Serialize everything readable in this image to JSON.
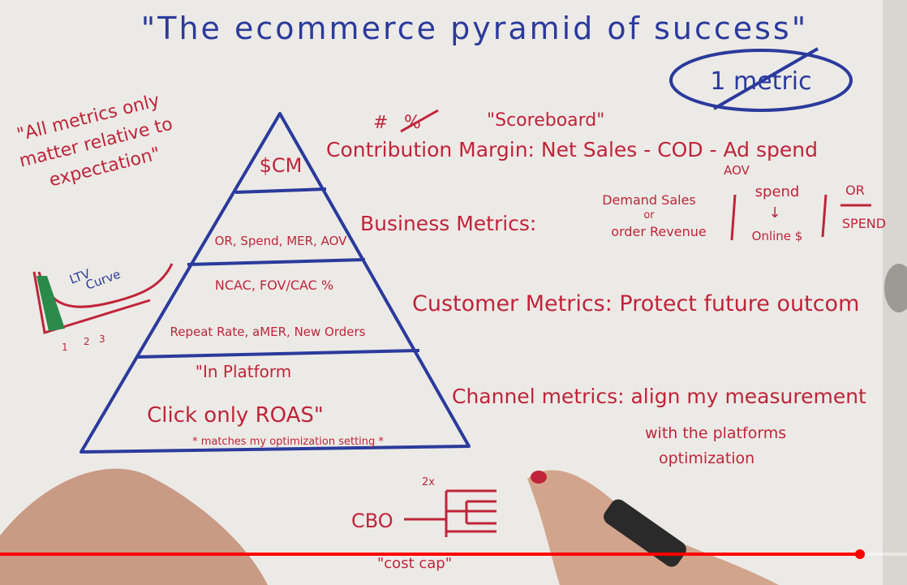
{
  "title": "\"The ecommerce pyramid of success\"",
  "one_metric": "1 metric",
  "quote": [
    "\"All metrics only",
    "matter relative to",
    "expectation\""
  ],
  "ltv": {
    "label1": "LTV",
    "label2": "Curve",
    "ticks": [
      "1",
      "2",
      "3"
    ]
  },
  "scoreboard": {
    "hash": "#",
    "struck": "%",
    "label": "\"Scoreboard\""
  },
  "pyramid": {
    "tier1": "$CM",
    "tier2": "OR, Spend, MER, AOV",
    "tier3a": "NCAC, FOV/CAC %",
    "tier3b": "Repeat Rate, aMER, New Orders",
    "tier4a": "\"In Platform",
    "tier4b": "Click only ROAS\"",
    "tier4c": "* matches my optimization setting *"
  },
  "contribution": "Contribution Margin: Net Sales - COD - Ad spend",
  "business": {
    "label": "Business Metrics:",
    "col1": [
      "Demand Sales",
      "or",
      "order Revenue"
    ],
    "aov": "AOV",
    "col2": [
      "spend",
      "↓",
      "Online $"
    ],
    "col3": [
      "OR",
      "SPEND"
    ]
  },
  "customer": "Customer Metrics: Protect future outcom",
  "channel": {
    "label": "Channel metrics: align my measurement",
    "line2": "with the platforms",
    "line3": "optimization"
  },
  "cbo": {
    "label": "CBO",
    "mult": "2x",
    "cost_cap": "\"cost cap\""
  },
  "colors": {
    "blue_marker": "#2b3a9c",
    "red_marker": "#c0243a",
    "progress": "#ff0000"
  },
  "video_progress_percent": 94.8
}
